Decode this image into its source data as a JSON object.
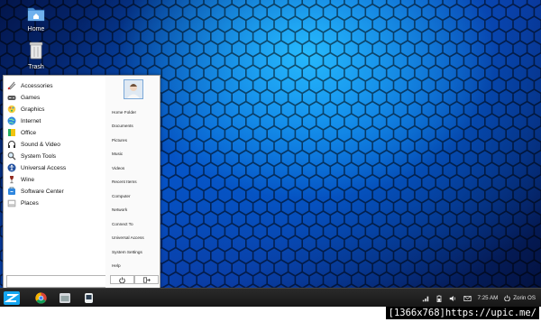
{
  "desktop": {
    "icons": [
      {
        "label": "Home"
      },
      {
        "label": "Trash"
      }
    ]
  },
  "menu": {
    "categories": [
      {
        "label": "Accessories"
      },
      {
        "label": "Games"
      },
      {
        "label": "Graphics"
      },
      {
        "label": "Internet"
      },
      {
        "label": "Office"
      },
      {
        "label": "Sound & Video"
      },
      {
        "label": "System Tools"
      },
      {
        "label": "Universal Access"
      },
      {
        "label": "Wine"
      },
      {
        "label": "Software Center"
      },
      {
        "label": "Places"
      }
    ],
    "places": [
      {
        "label": "Home Folder"
      },
      {
        "label": "Documents"
      },
      {
        "label": "Pictures"
      },
      {
        "label": "Music"
      },
      {
        "label": "Videos"
      },
      {
        "label": "Recent Items"
      },
      {
        "label": "Computer"
      },
      {
        "label": "Network"
      },
      {
        "label": "Connect To"
      },
      {
        "label": "Universal Access"
      },
      {
        "label": "System Settings"
      },
      {
        "label": "Help"
      }
    ],
    "search_value": "",
    "power_icon": "power-icon",
    "logout_icon": "logout-icon"
  },
  "taskbar": {
    "apps": [
      {
        "icon": "zorin-menu-icon"
      },
      {
        "icon": "chrome-icon"
      },
      {
        "icon": "files-icon"
      },
      {
        "icon": "terminal-icon"
      }
    ],
    "tray": {
      "clock": "7:25 AM",
      "os_label": "Zorin OS"
    }
  },
  "watermark": "[1366x768]https://upic.me/",
  "colors": {
    "accent": "#1e8fd6",
    "taskbar": "#1c1c1c"
  }
}
